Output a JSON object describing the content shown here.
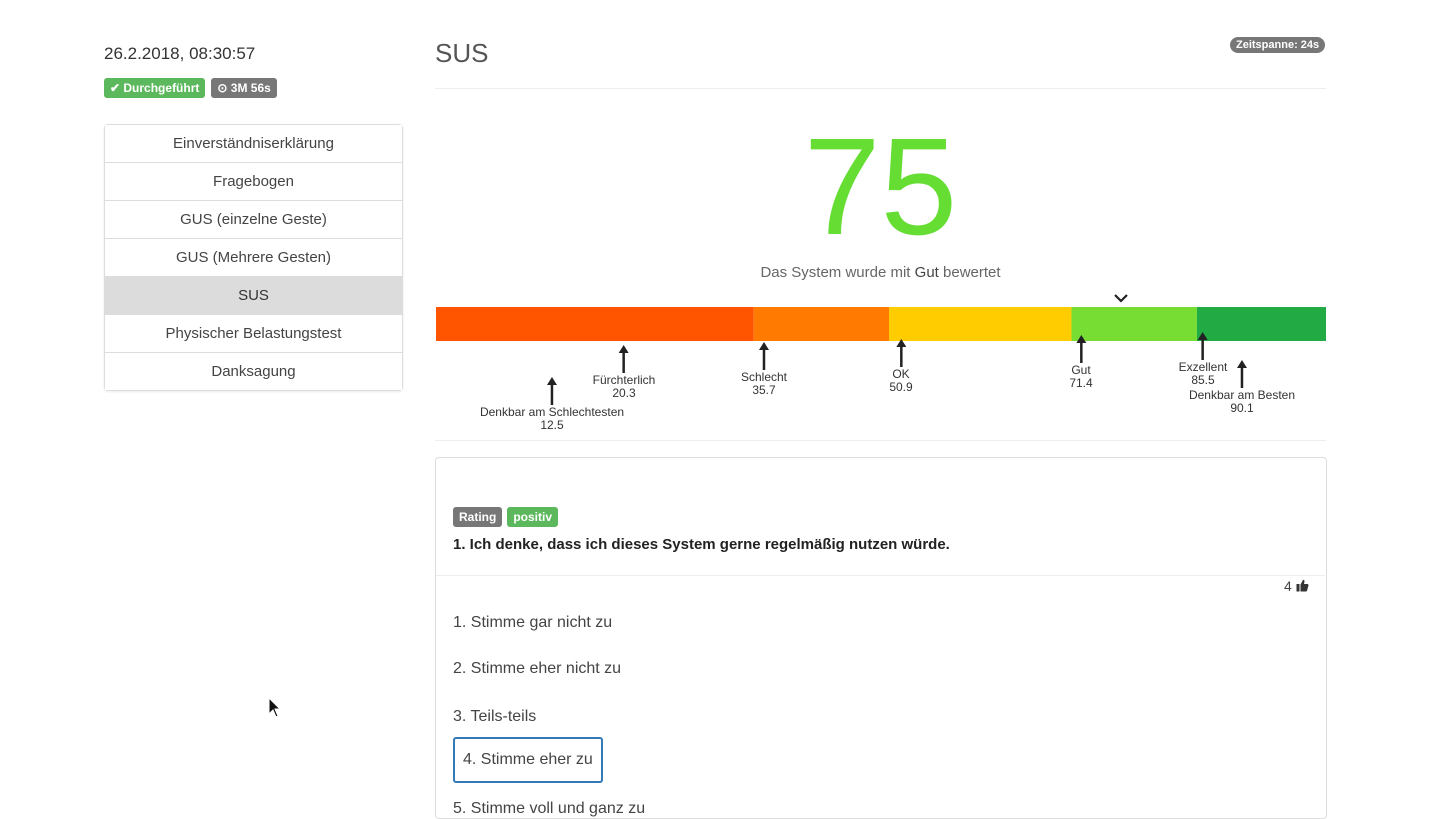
{
  "header": {
    "date": "26.2.2018, 08:30:57",
    "status_badge": "✔ Durchgeführt",
    "duration_badge": "⊙ 3M 56s"
  },
  "nav": {
    "items": [
      {
        "label": "Einverständniserklärung"
      },
      {
        "label": "Fragebogen"
      },
      {
        "label": "GUS (einzelne Geste)"
      },
      {
        "label": "GUS (Mehrere Gesten)"
      },
      {
        "label": "SUS"
      },
      {
        "label": "Physischer Belastungstest"
      },
      {
        "label": "Danksagung"
      }
    ],
    "active": "SUS"
  },
  "main": {
    "title": "SUS",
    "timespan": "Zeitspanne: 24s",
    "score": "75",
    "score_prefix": "Das System wurde mit",
    "score_rating": "Gut",
    "score_suffix": "bewertet"
  },
  "scale": {
    "segments": [
      {
        "from": 0,
        "to": 35.7,
        "color": "#ff5500"
      },
      {
        "from": 35.7,
        "to": 50.9,
        "color": "#ff7a00"
      },
      {
        "from": 50.9,
        "to": 71.4,
        "color": "#ffcc00"
      },
      {
        "from": 71.4,
        "to": 85.5,
        "color": "#77dd33"
      },
      {
        "from": 85.5,
        "to": 100,
        "color": "#22aa44"
      }
    ],
    "markers": [
      {
        "label": "Denkbar am Schlechtesten",
        "value": "12.5"
      },
      {
        "label": "Fürchterlich",
        "value": "20.3"
      },
      {
        "label": "Schlecht",
        "value": "35.7"
      },
      {
        "label": "OK",
        "value": "50.9"
      },
      {
        "label": "Gut",
        "value": "71.4"
      },
      {
        "label": "Exzellent",
        "value": "85.5"
      },
      {
        "label": "Denkbar am Besten",
        "value": "90.1"
      }
    ],
    "score_value": 75
  },
  "question": {
    "tag_rating": "Rating",
    "tag_positive": "positiv",
    "text": "1. Ich denke, dass ich dieses System gerne regelmäßig nutzen würde.",
    "answer_count": "4",
    "options": [
      "1. Stimme gar nicht zu",
      "2. Stimme eher nicht zu",
      "3. Teils-teils",
      "4. Stimme eher zu",
      "5. Stimme voll und ganz zu"
    ],
    "selected_index": 3
  },
  "icons": {
    "check": "check-icon",
    "clock": "clock-icon",
    "chevron": "chevron-down-icon",
    "thumb": "thumbs-up-icon",
    "cursor": "mouse-pointer-icon"
  }
}
